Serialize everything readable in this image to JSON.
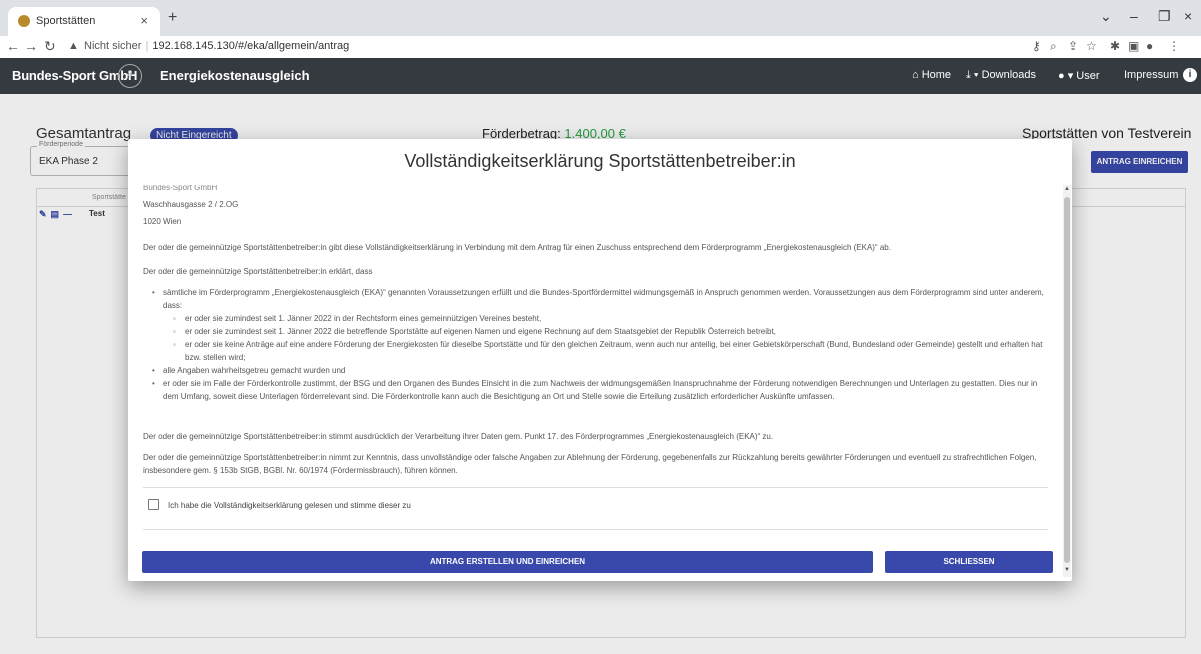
{
  "browser": {
    "tab_title": "Sportstätten",
    "tab_close": "×",
    "new_tab": "+",
    "url_warning": "Nicht sicher",
    "url": "192.168.145.130/#/eka/allgemein/antrag",
    "win_min": "‒",
    "win_max": "❐",
    "win_close": "×",
    "win_down": "⌄"
  },
  "navbar": {
    "brand": "Bundes-Sport GmbH",
    "app_title": "Energiekostenausgleich",
    "home": "Home",
    "downloads": "Downloads",
    "user": "User",
    "impressum": "Impressum"
  },
  "page": {
    "heading": "Gesamtantrag",
    "status_badge": "Nicht Eingereicht",
    "foerder_label": "Förderbetrag:",
    "foerder_amount": "1.400,00 €",
    "sport_title": "Sportstätten von Testverein",
    "periode_label": "Förderperiode",
    "periode_value": "EKA Phase 2",
    "submit_button": "ANTRAG EINREICHEN",
    "table_header": "Sportstätte",
    "row_name": "Test"
  },
  "modal": {
    "title": "Vollständigkeitserklärung Sportstättenbetreiber:in",
    "addr_cut": "Bundes-Sport GmbH",
    "addr_street": "Waschhausgasse 2 / 2.OG",
    "addr_city": "1020 Wien",
    "p1": "Der oder die gemeinnützige Sportstättenbetreiber:in gibt diese Vollständigkeitserklärung in Verbindung mit dem Antrag für einen Zuschuss entsprechend dem Förderprogramm „Energiekostenausgleich (EKA)“ ab.",
    "p2": "Der oder die gemeinnützige Sportstättenbetreiber:in erklärt, dass",
    "b1": "sämtliche im Förderprogramm „Energiekostenausgleich (EKA)“ genannten Voraussetzungen erfüllt und die Bundes-Sportfördermittel widmungsgemäß in Anspruch genommen werden. Voraussetzungen aus dem Förderprogramm sind unter anderem, dass:",
    "b1_sub1": "er oder sie zumindest seit 1. Jänner 2022 in der Rechtsform eines gemeinnützigen Vereines besteht,",
    "b1_sub2": "er oder sie zumindest seit 1. Jänner 2022 die betreffende Sportstätte auf eigenen Namen und eigene Rechnung auf dem Staatsgebiet der Republik Österreich betreibt,",
    "b1_sub3": "er oder sie keine Anträge auf eine andere Förderung der Energiekosten für dieselbe Sportstätte und für den gleichen Zeitraum, wenn auch nur anteilig, bei einer Gebietskörperschaft (Bund, Bundesland oder Gemeinde) gestellt und erhalten hat bzw. stellen wird;",
    "b2": "alle Angaben wahrheitsgetreu gemacht wurden und",
    "b3": "er oder sie im Falle der Förderkontrolle zustimmt, der BSG und den Organen des Bundes Einsicht in die zum Nachweis der widmungsgemäßen Inanspruchnahme der Förderung notwendigen Berechnungen und Unterlagen zu gestatten. Dies nur in dem Umfang, soweit diese Unterlagen förderrelevant sind. Die Förderkontrolle kann auch die Besichtigung an Ort und Stelle sowie die Erteilung zusätzlich erforderlicher Auskünfte umfassen.",
    "p3": "Der oder die gemeinnützige Sportstättenbetreiber:in stimmt ausdrücklich der Verarbeitung ihrer Daten gem. Punkt 17. des Förderprogrammes „Energiekostenausgleich (EKA)“ zu.",
    "p4": "Der oder die gemeinnützige Sportstättenbetreiber:in nimmt zur Kenntnis, dass unvollständige oder falsche Angaben zur Ablehnung der Förderung, gegebenenfalls zur Rückzahlung bereits gewährter Förderungen und eventuell zu strafrechtlichen Folgen, insbesondere gem. § 153b StGB, BGBl. Nr. 60/1974 (Fördermissbrauch), führen können.",
    "checkbox_label": "Ich habe die Vollständigkeitserklärung gelesen und stimme dieser zu",
    "btn_submit": "ANTRAG ERSTELLEN UND EINREICHEN",
    "btn_close": "SCHLIESSEN"
  },
  "colors": {
    "accent": "#3949ab",
    "navbar": "#343a40",
    "amount": "#28a745"
  }
}
